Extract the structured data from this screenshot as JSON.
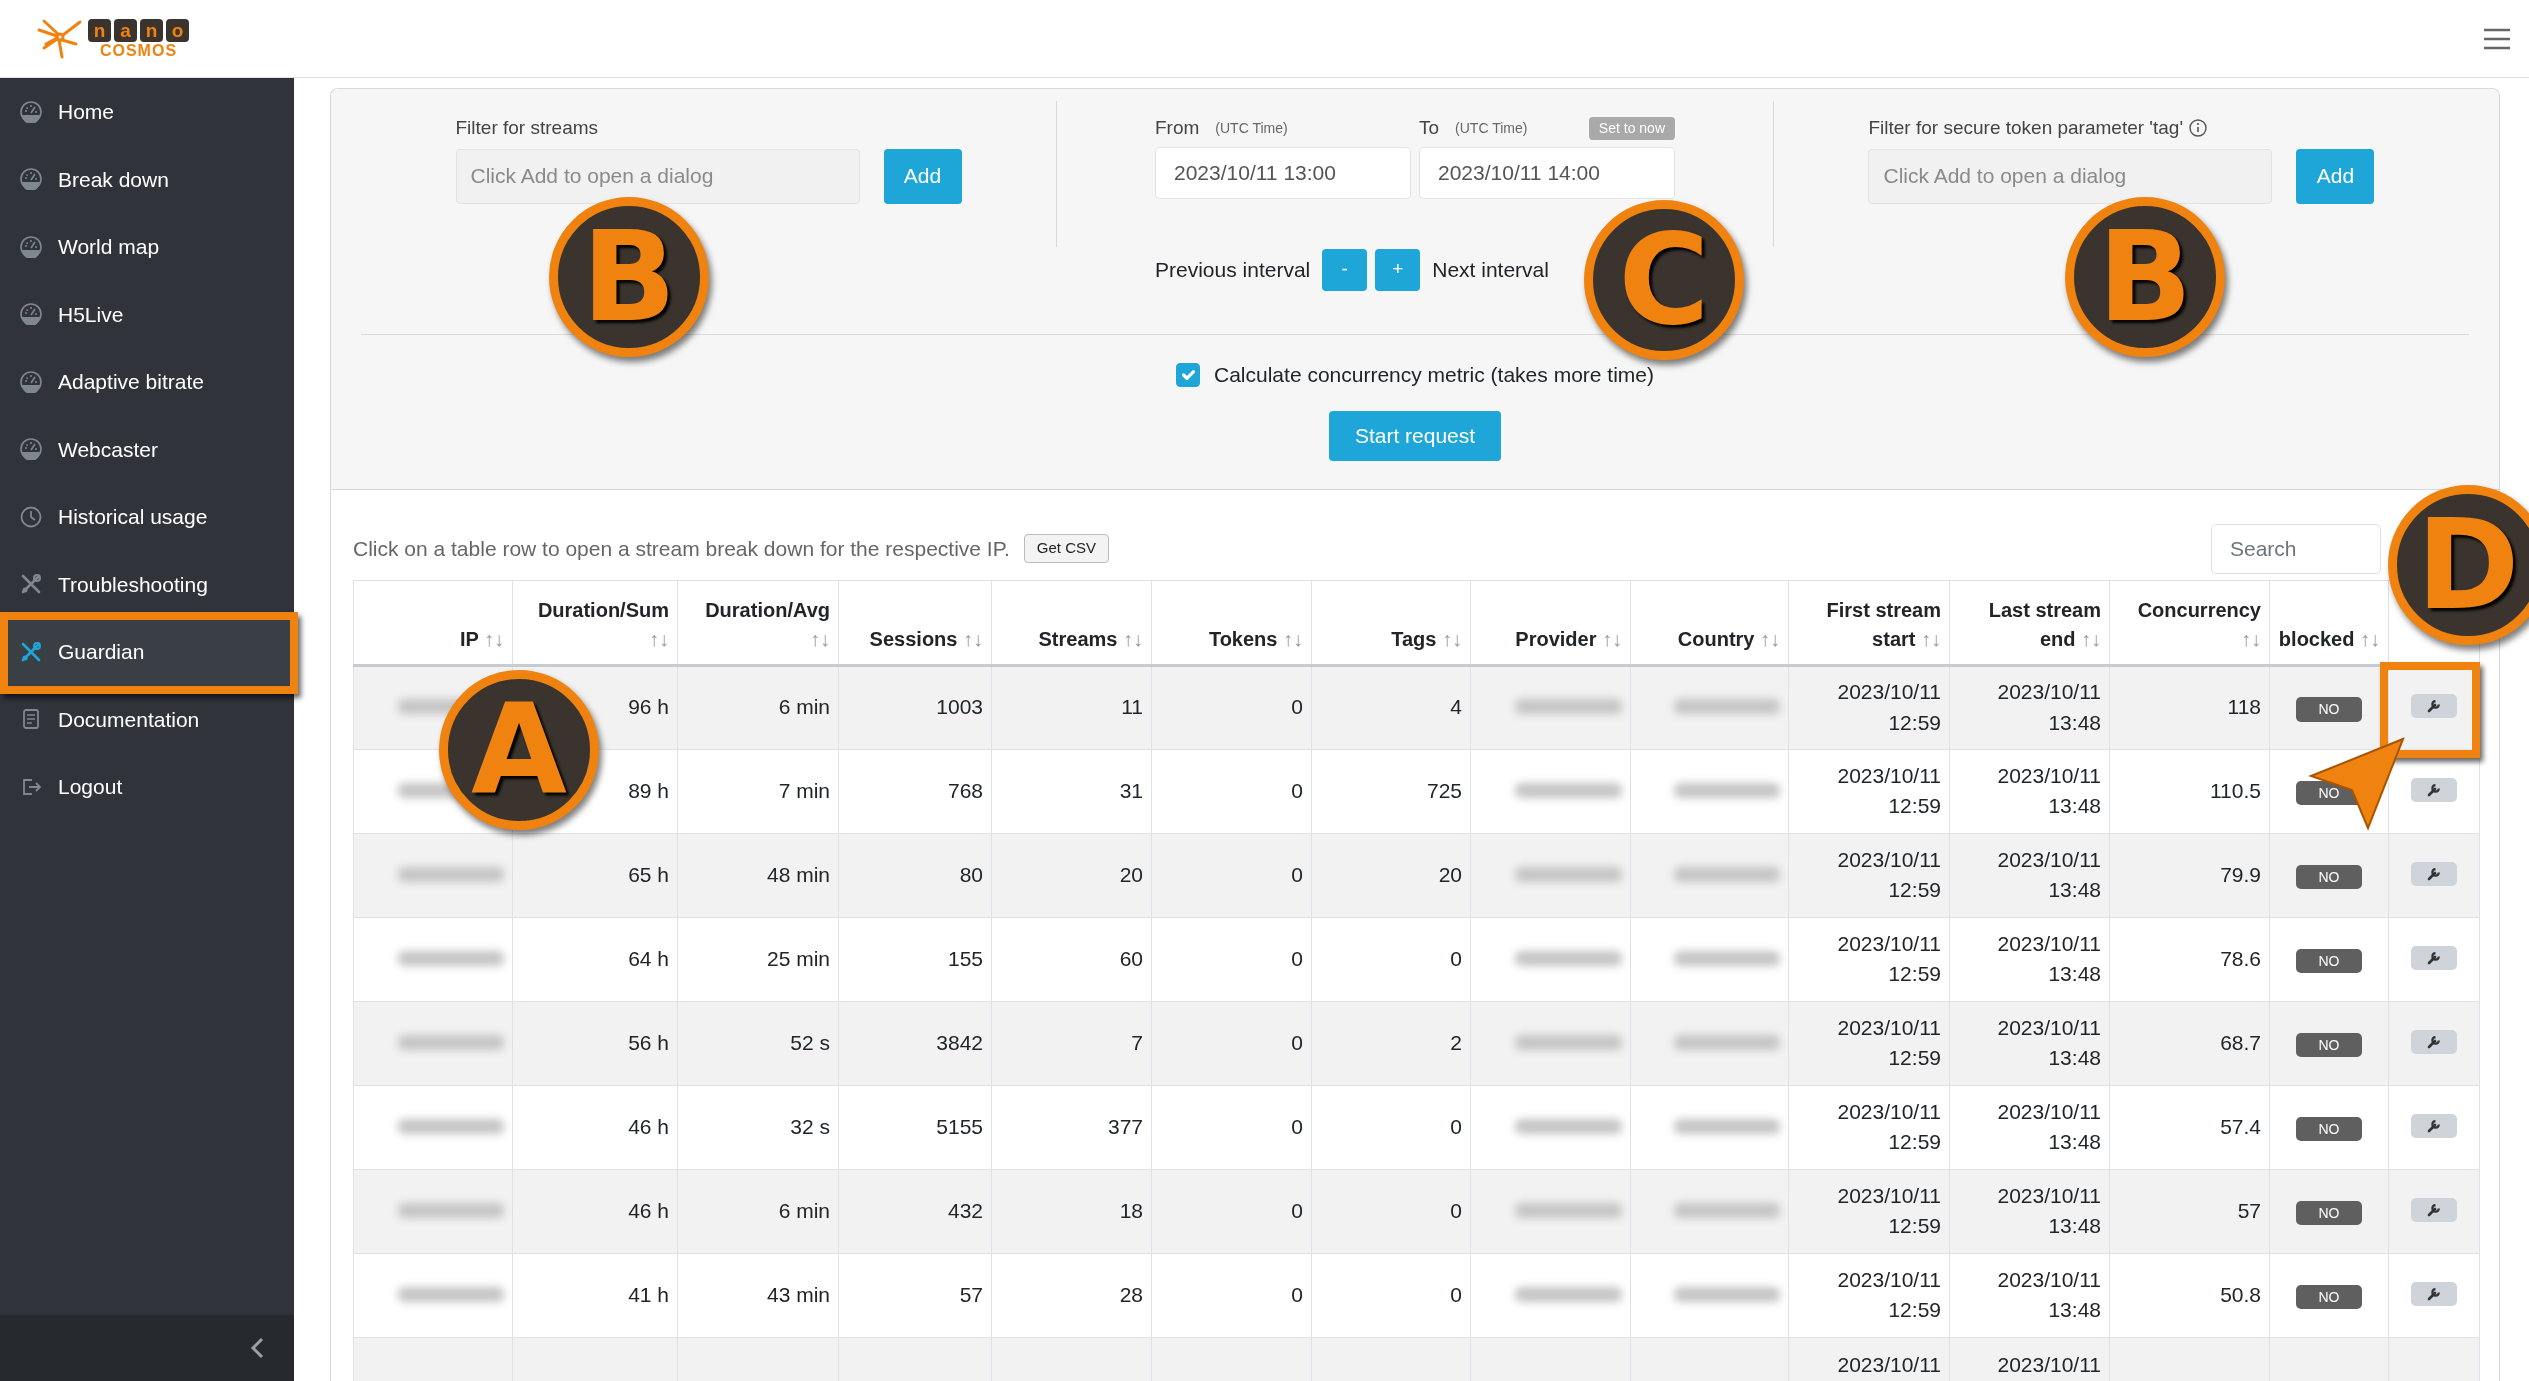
{
  "logo": {
    "letters": [
      "n",
      "a",
      "n",
      "o"
    ],
    "word": "COSMOS"
  },
  "sidebar": {
    "items": [
      {
        "label": "Home",
        "kind": "gauge",
        "selected": false
      },
      {
        "label": "Break down",
        "kind": "gauge",
        "selected": false
      },
      {
        "label": "World map",
        "kind": "gauge",
        "selected": false
      },
      {
        "label": "H5Live",
        "kind": "gauge",
        "selected": false
      },
      {
        "label": "Adaptive bitrate",
        "kind": "gauge",
        "selected": false
      },
      {
        "label": "Webcaster",
        "kind": "gauge",
        "selected": false
      },
      {
        "label": "Historical usage",
        "kind": "clock",
        "selected": false
      },
      {
        "label": "Troubleshooting",
        "kind": "tools",
        "selected": false
      },
      {
        "label": "Guardian",
        "kind": "tools",
        "selected": true
      },
      {
        "label": "Documentation",
        "kind": "doc",
        "selected": false
      },
      {
        "label": "Logout",
        "kind": "logout",
        "selected": false
      }
    ]
  },
  "filters": [
    {
      "label": "Filter for streams",
      "placeholder": "Click Add to open a dialog",
      "button": "Add"
    },
    {
      "label": "Filter for secure token parameter 'tag'",
      "placeholder": "Click Add to open a dialog",
      "button": "Add",
      "info": true
    }
  ],
  "time": {
    "from_label": "From",
    "from_hint": "(UTC Time)",
    "from_value": "2023/10/11 13:00",
    "to_label": "To",
    "to_hint": "(UTC Time)",
    "to_value": "2023/10/11 14:00",
    "set_now": "Set to now",
    "previous": "Previous interval",
    "minus": "-",
    "plus": "+",
    "next": "Next interval"
  },
  "concurrency": {
    "label": "Calculate concurrency metric (takes more time)",
    "checked": true
  },
  "start_button": "Start request",
  "table": {
    "hint": "Click on a table row to open a stream break down for the respective IP.",
    "csv_button": "Get CSV",
    "search_placeholder": "Search",
    "columns": [
      {
        "label": "IP",
        "sort": "↑↓",
        "kind": "blurred"
      },
      {
        "label": "Duration/Sum",
        "sort": "↑↓",
        "kind": "text"
      },
      {
        "label": "Duration/Avg",
        "sort": "↑↓",
        "kind": "text"
      },
      {
        "label": "Sessions",
        "sort": "↑↓",
        "kind": "text"
      },
      {
        "label": "Streams",
        "sort": "↑↓",
        "kind": "text"
      },
      {
        "label": "Tokens",
        "sort": "↑↓",
        "kind": "text"
      },
      {
        "label": "Tags",
        "sort": "↑↓",
        "kind": "text"
      },
      {
        "label": "Provider",
        "sort": "↑↓",
        "kind": "blurred"
      },
      {
        "label": "Country",
        "sort": "↑↓",
        "kind": "blurred"
      },
      {
        "label": "First stream start",
        "sort": "↑↓",
        "kind": "date"
      },
      {
        "label": "Last stream end",
        "sort": "↑↓",
        "kind": "date"
      },
      {
        "label": "Concurrency",
        "sort": "↑↓",
        "kind": "text"
      },
      {
        "label": "blocked",
        "sort": "↑↓",
        "kind": "badge"
      },
      {
        "kind": "action"
      }
    ],
    "rows": [
      {
        "cells": [
          "",
          "96 h",
          "6 min",
          "1003",
          "11",
          "0",
          "4",
          "",
          "",
          "2023/10/11 12:59",
          "2023/10/11 13:48",
          "118",
          "NO",
          ""
        ]
      },
      {
        "cells": [
          "",
          "89 h",
          "7 min",
          "768",
          "31",
          "0",
          "725",
          "",
          "",
          "2023/10/11 12:59",
          "2023/10/11 13:48",
          "110.5",
          "NO",
          ""
        ]
      },
      {
        "cells": [
          "",
          "65 h",
          "48 min",
          "80",
          "20",
          "0",
          "20",
          "",
          "",
          "2023/10/11 12:59",
          "2023/10/11 13:48",
          "79.9",
          "NO",
          ""
        ]
      },
      {
        "cells": [
          "",
          "64 h",
          "25 min",
          "155",
          "60",
          "0",
          "0",
          "",
          "",
          "2023/10/11 12:59",
          "2023/10/11 13:48",
          "78.6",
          "NO",
          ""
        ]
      },
      {
        "cells": [
          "",
          "56 h",
          "52 s",
          "3842",
          "7",
          "0",
          "2",
          "",
          "",
          "2023/10/11 12:59",
          "2023/10/11 13:48",
          "68.7",
          "NO",
          ""
        ]
      },
      {
        "cells": [
          "",
          "46 h",
          "32 s",
          "5155",
          "377",
          "0",
          "0",
          "",
          "",
          "2023/10/11 12:59",
          "2023/10/11 13:48",
          "57.4",
          "NO",
          ""
        ]
      },
      {
        "cells": [
          "",
          "46 h",
          "6 min",
          "432",
          "18",
          "0",
          "0",
          "",
          "",
          "2023/10/11 12:59",
          "2023/10/11 13:48",
          "57",
          "NO",
          ""
        ]
      },
      {
        "cells": [
          "",
          "41 h",
          "43 min",
          "57",
          "28",
          "0",
          "0",
          "",
          "",
          "2023/10/11 12:59",
          "2023/10/11 13:48",
          "50.8",
          "NO",
          ""
        ]
      },
      {
        "partial": true,
        "cells": [
          "",
          "",
          "",
          "",
          "",
          "",
          "",
          "",
          "",
          "2023/10/11",
          "2023/10/11",
          "",
          "",
          ""
        ]
      }
    ]
  },
  "annotations": [
    {
      "kind": "badge",
      "label": "B"
    },
    {
      "kind": "badge",
      "label": "C"
    },
    {
      "kind": "badge",
      "label": "B"
    },
    {
      "kind": "badge",
      "label": "D"
    },
    {
      "kind": "badge",
      "label": "A"
    },
    {
      "kind": "frame"
    },
    {
      "kind": "frame"
    },
    {
      "kind": "arrow"
    }
  ]
}
